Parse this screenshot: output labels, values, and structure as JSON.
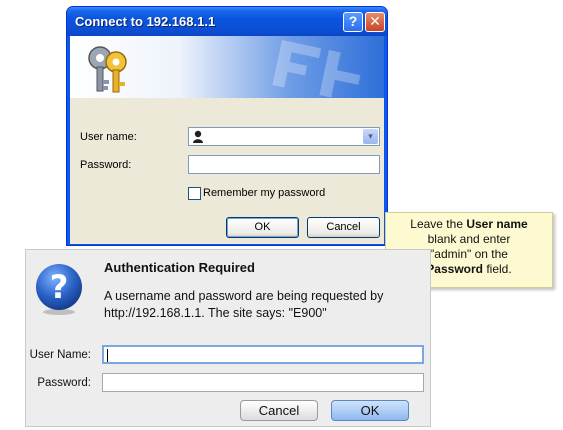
{
  "xp_dialog": {
    "title": "Connect to 192.168.1.1",
    "help_glyph": "?",
    "close_glyph": "✕",
    "username_label": "User name:",
    "password_label": "Password:",
    "username_value": "",
    "password_value": "",
    "remember_label": "Remember my password",
    "remember_checked": false,
    "ok_label": "OK",
    "cancel_label": "Cancel",
    "combo_arrow": "▾"
  },
  "callout": {
    "line1_prefix": "Leave the ",
    "line1_bold": "User name",
    "line2": "blank and enter",
    "line3": "\"admin\" on the",
    "line4_bold": "Password",
    "line4_suffix": " field."
  },
  "ff_dialog": {
    "heading": "Authentication Required",
    "message": "A username and password are being requested by http://192.168.1.1. The site says: \"E900\"",
    "username_label": "User Name:",
    "password_label": "Password:",
    "username_value": "",
    "password_value": "",
    "cancel_label": "Cancel",
    "ok_label": "OK",
    "icon_glyph": "?"
  },
  "colors": {
    "xp_title_blue": "#0a55e0",
    "callout_bg": "#fdfad2",
    "ff_ok_blue": "#8fb8ee",
    "question_icon_blue": "#2b63c8"
  }
}
